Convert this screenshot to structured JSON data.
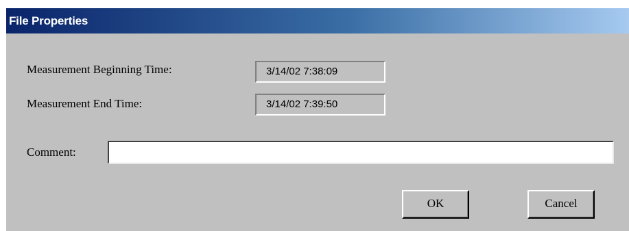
{
  "window": {
    "title": "File Properties"
  },
  "fields": {
    "begin_label": "Measurement Beginning Time:",
    "begin_value": "3/14/02 7:38:09",
    "end_label": "Measurement End Time:",
    "end_value": "3/14/02 7:39:50",
    "comment_label": "Comment:",
    "comment_value": ""
  },
  "buttons": {
    "ok_label": "OK",
    "cancel_label": "Cancel"
  },
  "colors": {
    "titlebar_start": "#0a246a",
    "titlebar_end": "#a6caf0",
    "dialog_face": "#c0c0c0"
  }
}
